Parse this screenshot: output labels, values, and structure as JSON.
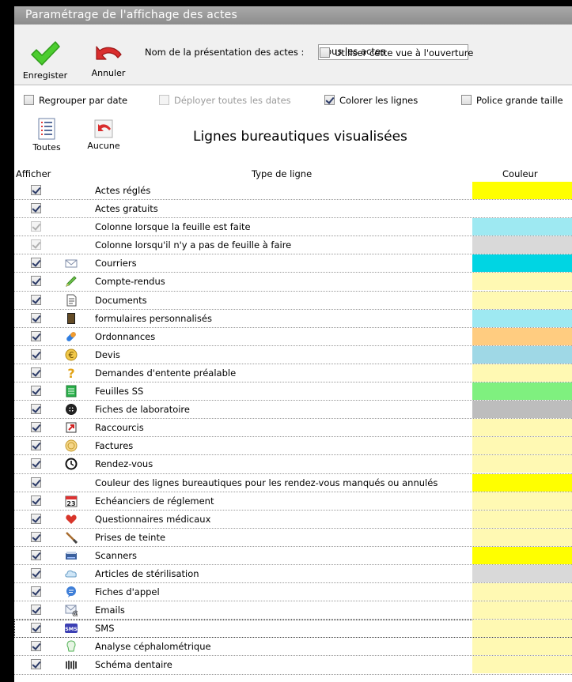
{
  "window": {
    "title": "Paramétrage de l'affichage des actes"
  },
  "toolbar": {
    "save_label": "Enregister",
    "cancel_label": "Annuler",
    "presentation_label": "Nom de la présentation des actes :",
    "presentation_value": "Tous les actes",
    "use_view_label": "Utiliser cette vue à l'ouverture",
    "use_view_checked": false
  },
  "options": {
    "group_by_date": {
      "label": "Regrouper par date",
      "checked": false
    },
    "deploy_all_dates": {
      "label": "Déployer toutes les dates",
      "checked": false,
      "disabled": true
    },
    "color_lines": {
      "label": "Colorer les lignes",
      "checked": true
    },
    "big_font": {
      "label": "Police grande taille",
      "checked": false
    }
  },
  "selection": {
    "all_label": "Toutes",
    "none_label": "Aucune"
  },
  "section_title": "Lignes bureautiques visualisées",
  "table": {
    "headers": {
      "show": "Afficher",
      "type": "Type de ligne",
      "color": "Couleur"
    },
    "rows": [
      {
        "label": "Actes réglés",
        "icon": "",
        "checked": true,
        "disabled": false,
        "color": "#ffff00"
      },
      {
        "label": "Actes gratuits",
        "icon": "",
        "checked": true,
        "disabled": false,
        "color": "#ffffff"
      },
      {
        "label": "Colonne lorsque la feuille est faite",
        "icon": "",
        "checked": true,
        "disabled": true,
        "color": "#9ee9f2"
      },
      {
        "label": "Colonne lorsqu'il n'y a pas de feuille à faire",
        "icon": "",
        "checked": true,
        "disabled": true,
        "color": "#d9d9d9"
      },
      {
        "label": "Courriers",
        "icon": "envelope-icon",
        "checked": true,
        "disabled": false,
        "color": "#00d5e3"
      },
      {
        "label": "Compte-rendus",
        "icon": "pencil-icon",
        "checked": true,
        "disabled": false,
        "color": "#fff9b3"
      },
      {
        "label": "Documents",
        "icon": "document-icon",
        "checked": true,
        "disabled": false,
        "color": "#fff9b3"
      },
      {
        "label": "formulaires personnalisés",
        "icon": "form-icon",
        "checked": true,
        "disabled": false,
        "color": "#9ee9f2"
      },
      {
        "label": "Ordonnances",
        "icon": "pill-icon",
        "checked": true,
        "disabled": false,
        "color": "#ffcc80"
      },
      {
        "label": "Devis",
        "icon": "euro-icon",
        "checked": true,
        "disabled": false,
        "color": "#9fd8e6"
      },
      {
        "label": "Demandes d'entente préalable",
        "icon": "question-icon",
        "checked": true,
        "disabled": false,
        "color": "#fff9b3"
      },
      {
        "label": "Feuilles SS",
        "icon": "sheet-icon",
        "checked": true,
        "disabled": false,
        "color": "#7ff07f"
      },
      {
        "label": "Fiches de laboratoire",
        "icon": "lab-icon",
        "checked": true,
        "disabled": false,
        "color": "#bdbdbd"
      },
      {
        "label": "Raccourcis",
        "icon": "shortcut-icon",
        "checked": true,
        "disabled": false,
        "color": "#fff9b3"
      },
      {
        "label": "Factures",
        "icon": "coin-icon",
        "checked": true,
        "disabled": false,
        "color": "#fff9b3"
      },
      {
        "label": "Rendez-vous",
        "icon": "clock-icon",
        "checked": true,
        "disabled": false,
        "color": "#fff9b3"
      },
      {
        "label": "Couleur des lignes bureautiques pour les rendez-vous manqués ou annulés",
        "icon": "",
        "checked": true,
        "disabled": false,
        "color": "#ffff00"
      },
      {
        "label": "Echéanciers de réglement",
        "icon": "calendar-icon",
        "checked": true,
        "disabled": false,
        "color": "#fff9b3"
      },
      {
        "label": "Questionnaires médicaux",
        "icon": "heart-icon",
        "checked": true,
        "disabled": false,
        "color": "#fff9b3"
      },
      {
        "label": "Prises de teinte",
        "icon": "brush-icon",
        "checked": true,
        "disabled": false,
        "color": "#fff9b3"
      },
      {
        "label": "Scanners",
        "icon": "scanner-icon",
        "checked": true,
        "disabled": false,
        "color": "#ffff00"
      },
      {
        "label": "Articles de stérilisation",
        "icon": "cloud-icon",
        "checked": true,
        "disabled": false,
        "color": "#d9d9d9"
      },
      {
        "label": "Fiches d'appel",
        "icon": "chat-icon",
        "checked": true,
        "disabled": false,
        "color": "#fff9b3"
      },
      {
        "label": "Emails",
        "icon": "email-icon",
        "checked": true,
        "disabled": false,
        "color": "#fff9b3"
      },
      {
        "label": "SMS",
        "icon": "sms-icon",
        "checked": true,
        "disabled": false,
        "color": "#fff9b3",
        "selected": true
      },
      {
        "label": "Analyse céphalométrique",
        "icon": "skull-icon",
        "checked": true,
        "disabled": false,
        "color": "#fff9b3"
      },
      {
        "label": "Schéma dentaire",
        "icon": "teeth-icon",
        "checked": true,
        "disabled": false,
        "color": "#fff9b3"
      }
    ]
  }
}
